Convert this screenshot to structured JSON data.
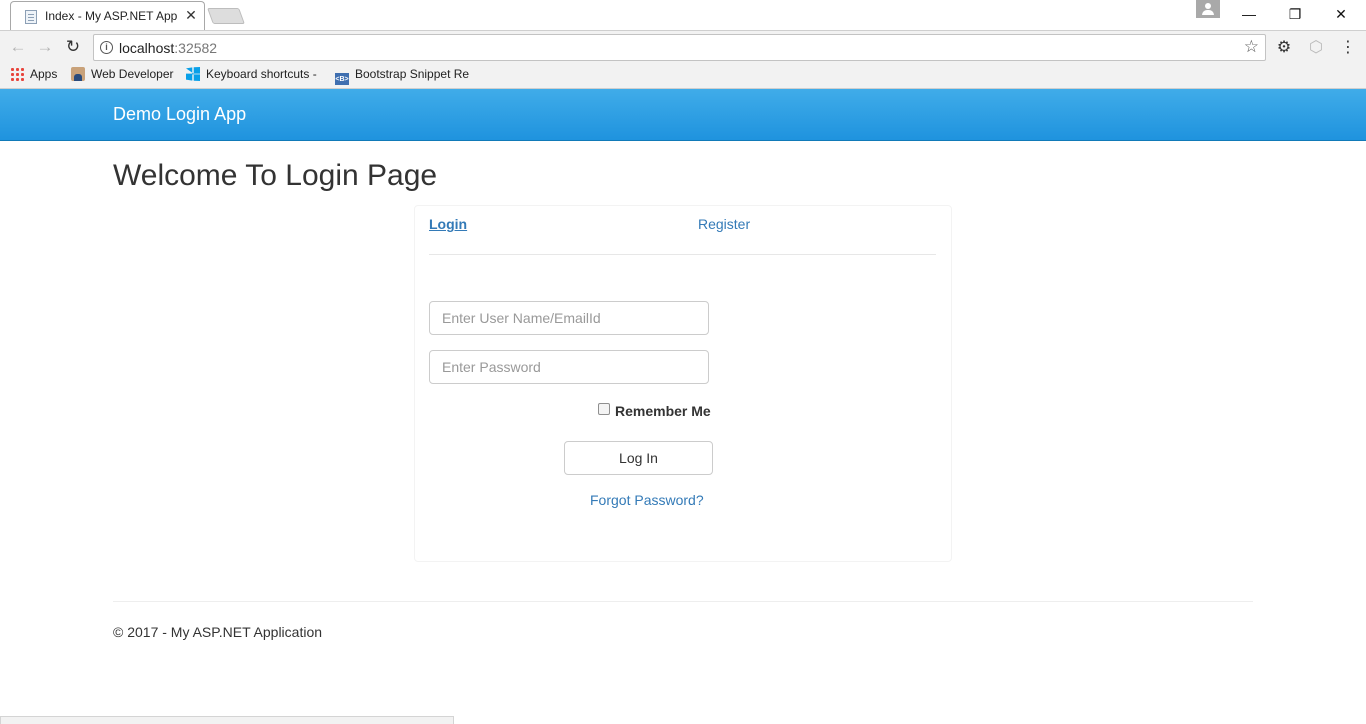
{
  "browser": {
    "tab_title": "Index - My ASP.NET Appl",
    "tab_close": "✕",
    "url_host": "localhost",
    "url_port": ":32582",
    "window_controls": {
      "minimize": "—",
      "restore": "❐",
      "close": "✕"
    }
  },
  "bookmarks": [
    {
      "label": "Apps",
      "icon": "apps-grid-icon"
    },
    {
      "label": "Web Developer",
      "icon": "web-developer-icon"
    },
    {
      "label": "Keyboard shortcuts -",
      "icon": "windows-icon"
    },
    {
      "label": "Bootstrap Snippet Re",
      "icon": "bootstrap-icon"
    }
  ],
  "navbar": {
    "brand": "Demo Login App"
  },
  "main": {
    "title": "Welcome To Login Page",
    "tabs": {
      "login": "Login",
      "register": "Register"
    },
    "username_placeholder": "Enter User Name/EmailId",
    "password_placeholder": "Enter Password",
    "remember_me": "Remember Me",
    "login_button": "Log In",
    "forgot_password": "Forgot Password?"
  },
  "footer": {
    "text": "© 2017 - My ASP.NET Application"
  },
  "colors": {
    "navbar": "#2199e0",
    "link": "#337ab7"
  }
}
